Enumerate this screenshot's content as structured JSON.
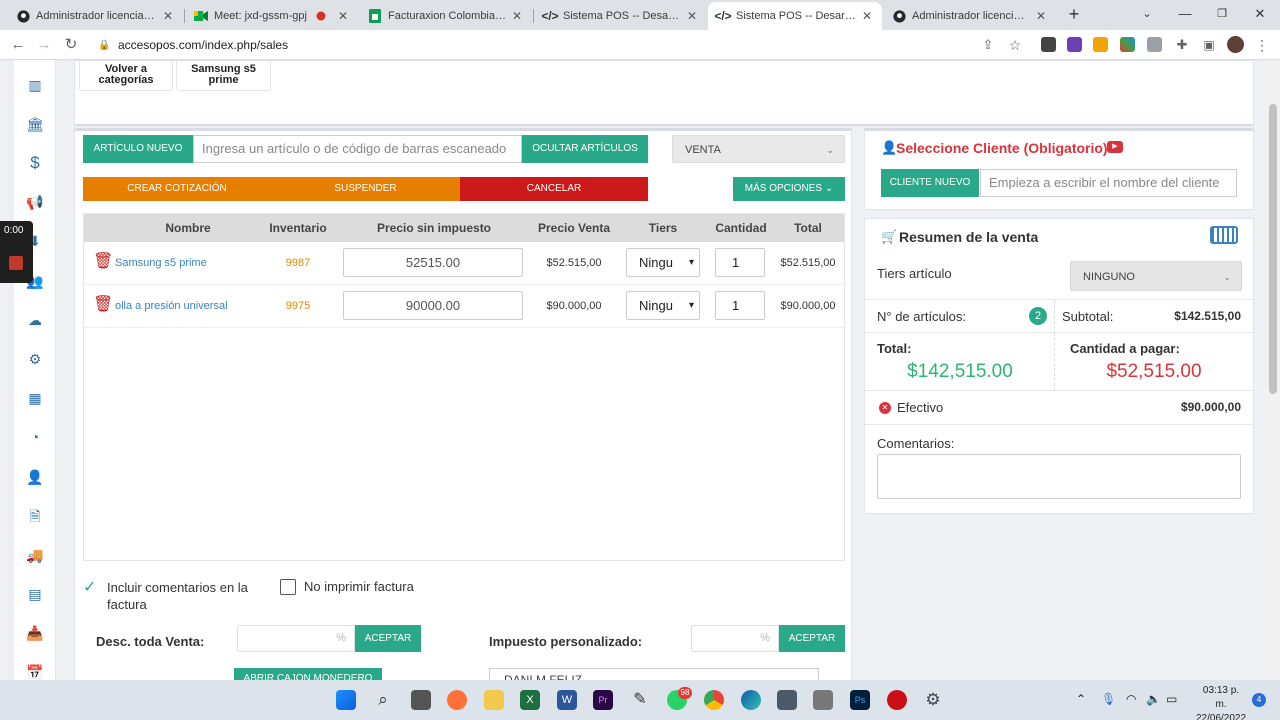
{
  "browser": {
    "tabs": [
      {
        "icon": "github-icon",
        "title": "Administrador licencias POS",
        "color": "#3c3c3c"
      },
      {
        "icon": "meet-icon",
        "title": "Meet: jxd-gssm-gpj",
        "color": "#3c3c3c"
      },
      {
        "icon": "sheets-icon",
        "title": "Facturaxion Colombia altas",
        "color": "#3c3c3c"
      },
      {
        "icon": "code-icon",
        "title": "Sistema POS -- Desarrollado",
        "color": "#3c3c3c"
      },
      {
        "icon": "code-icon",
        "title": "Sistema POS -- Desarrollado",
        "color": "#3c3c3c",
        "active": true
      },
      {
        "icon": "github-icon",
        "title": "Administrador licencias POS",
        "color": "#3c3c3c"
      }
    ],
    "url": "accesopos.com/index.php/sales"
  },
  "recorder": {
    "time": "0:00"
  },
  "categories": {
    "back_label": "Volver a categorías",
    "item_label": "Samsung s5 prime"
  },
  "sales": {
    "new_item_label": "ARTÍCULO NUEVO",
    "search_placeholder": "Ingresa un artículo o de código de barras escaneado",
    "hide_items_label": "OCULTAR ARTÍCULOS",
    "mode_value": "VENTA",
    "create_quote_label": "CREAR COTIZACIÓN",
    "suspend_label": "SUSPENDER",
    "cancel_label": "CANCELAR",
    "more_options_label": "MÁS OPCIONES",
    "columns": [
      "Nombre",
      "Inventario",
      "Precio sin impuesto",
      "Precio Venta",
      "Tiers",
      "Cantidad",
      "Total"
    ],
    "rows": [
      {
        "name": "Samsung s5 prime",
        "inventory": "9987",
        "price_no_tax": "52515.00",
        "sale_price": "$52.515,00",
        "tier": "Ningu",
        "qty": "1",
        "total": "$52.515,00"
      },
      {
        "name": "olla a presión universal",
        "inventory": "9975",
        "price_no_tax": "90000.00",
        "sale_price": "$90.000,00",
        "tier": "Ningu",
        "qty": "1",
        "total": "$90.000,00"
      }
    ],
    "include_comments_label": "Incluir comentarios en la factura",
    "no_print_label": "No imprimir factura",
    "discount_label": "Desc. toda Venta:",
    "discount_pct": "%",
    "accept_label": "ACEPTAR",
    "custom_tax_label": "Impuesto personalizado:",
    "tax_pct": "%",
    "accept_label_2": "ACEPTAR",
    "open_drawer_label": "ABRIR CAJON MONEDERO",
    "employee_value": "DANI M FELIZ"
  },
  "client": {
    "title": "Seleccione Cliente (Obligatorio)",
    "new_client_label": "CLIENTE NUEVO",
    "search_placeholder": "Empieza a escribir el nombre del cliente"
  },
  "summary": {
    "title": "Resumen de la venta",
    "tiers_label": "Tiers artículo",
    "tiers_value": "NINGUNO",
    "items_label": "N° de artículos:",
    "items_count": "2",
    "subtotal_label": "Subtotal:",
    "subtotal_value": "$142.515,00",
    "total_label": "Total:",
    "total_value": "$142,515.00",
    "to_pay_label": "Cantidad a pagar:",
    "to_pay_value": "$52,515.00",
    "payment_method": "Efectivo",
    "payment_amount": "$90.000,00",
    "comments_label": "Comentarios:"
  },
  "taskbar": {
    "whatsapp_badge": "98",
    "time": "03:13 p. m.",
    "date": "22/06/2022",
    "notif_count": "4"
  },
  "colors": {
    "accent": "#2aa98a",
    "orange": "#e67e00",
    "danger": "#cc1a1a",
    "total_green": "#2bb673",
    "to_pay_red": "#d8343c",
    "link_blue": "#3b82c4"
  }
}
